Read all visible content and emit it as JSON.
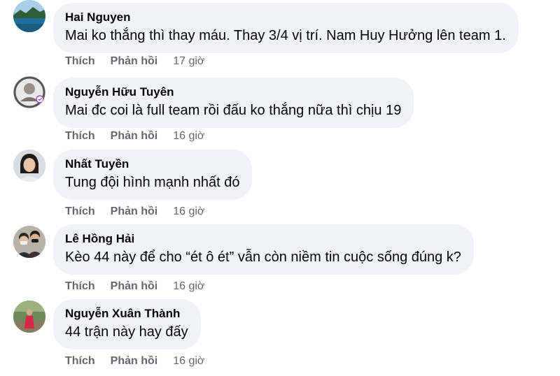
{
  "actions": {
    "like_label": "Thích",
    "reply_label": "Phản hồi"
  },
  "comments": [
    {
      "author": "Hai Nguyen",
      "text": "Mai ko thắng thì thay máu. Thay 3/4 vị trí. Nam Huy Hưởng lên team 1.",
      "time": "17 giờ",
      "avatar": "landscape-lake"
    },
    {
      "author": "Nguyễn Hữu Tuyên",
      "text": "Mai đc coi là full team rồi đấu ko thắng nữa thì chịu 19",
      "time": "16 giờ",
      "avatar": "badge-photo"
    },
    {
      "author": "Nhất Tuyền",
      "text": "Tung đội hình mạnh nhất đó",
      "time": "16 giờ",
      "avatar": "portrait-woman"
    },
    {
      "author": "Lê Hồng Hải",
      "text": "Kèo 44 này để cho “ét ô ét” vẫn còn niềm tin cuộc sống đúng k?",
      "time": "16 giờ",
      "avatar": "portrait-couple-masked"
    },
    {
      "author": "Nguyễn Xuân Thành",
      "text": "44 trận này hay đấy",
      "time": "16 giờ",
      "avatar": "portrait-outdoor-red"
    }
  ],
  "colors": {
    "bubble_bg": "#f0f2f5",
    "text": "#050505",
    "secondary": "#65676b"
  }
}
